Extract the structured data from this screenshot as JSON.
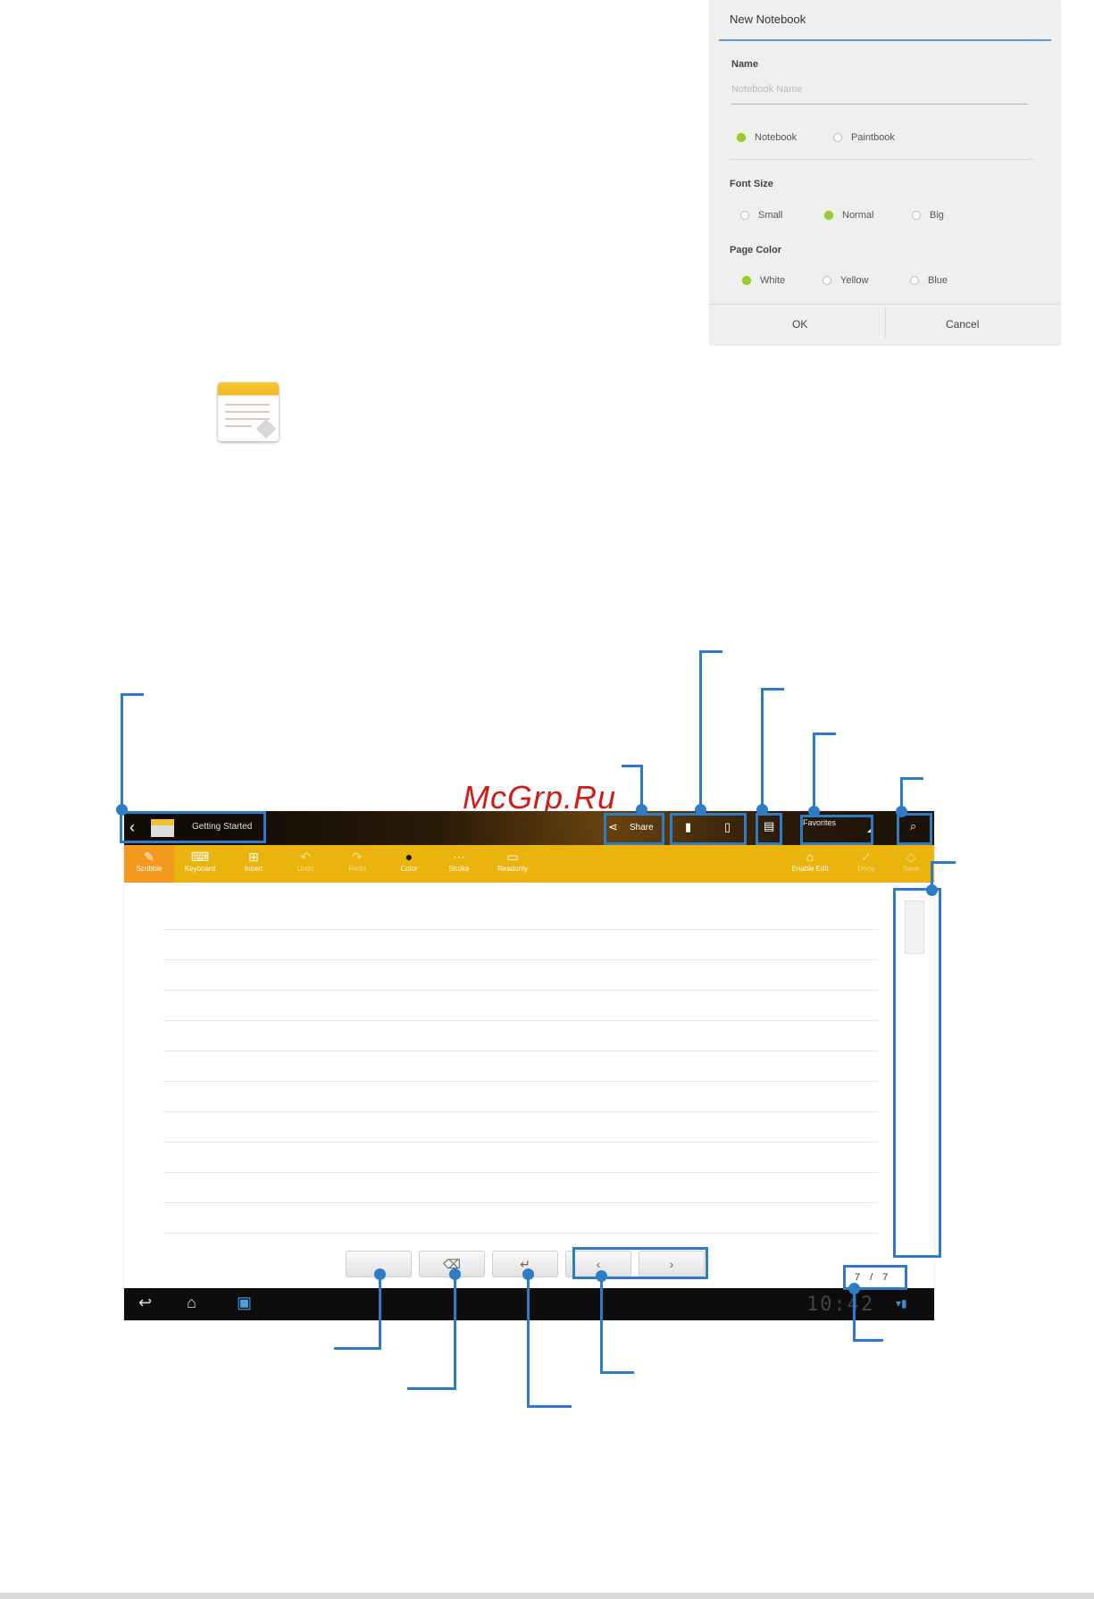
{
  "dialog": {
    "title": "New Notebook",
    "name_label": "Name",
    "name_placeholder": "Notebook Name",
    "type_options": [
      "Notebook",
      "Paintbook"
    ],
    "type_selected": "Notebook",
    "font_size_label": "Font Size",
    "font_size_options": [
      "Small",
      "Normal",
      "Big"
    ],
    "font_size_selected": "Normal",
    "page_color_label": "Page Color",
    "page_color_options": [
      "White",
      "Yellow",
      "Blue"
    ],
    "page_color_selected": "White",
    "ok_label": "OK",
    "cancel_label": "Cancel"
  },
  "app": {
    "notebook_title": "Getting Started",
    "share_label": "Share",
    "favorites_label": "Favorites",
    "tools": [
      "Scribble",
      "Keyboard",
      "Insert",
      "Undo",
      "Redo",
      "Color",
      "Stroke",
      "Readonly",
      "Enable Edit",
      "Done",
      "Save"
    ],
    "page_indicator": "7 / 7",
    "clock": "10:42"
  },
  "watermark": "McGrp.Ru",
  "colors": {
    "accent": "#2e7bc6",
    "toolbar": "#eab40c",
    "watermark": "#d11a1a"
  }
}
